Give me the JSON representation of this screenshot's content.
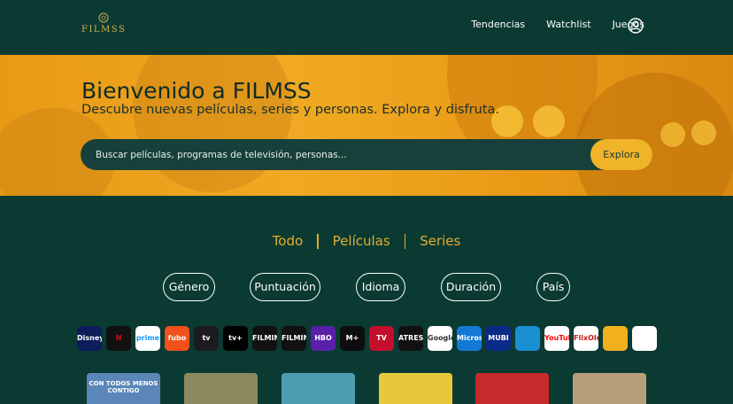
{
  "header": {
    "logo_text": "FILMSS",
    "nav": [
      "Tendencias",
      "Watchlist",
      "Juegos"
    ],
    "user_icon": "user-circle-icon"
  },
  "hero": {
    "title": "Bienvenido a FILMSS",
    "subtitle": "Descubre nuevas películas, series y personas. Explora y disfruta.",
    "search_placeholder": "Buscar películas, programas de televisión, personas...",
    "search_button": "Explora"
  },
  "tabs": [
    "Todo",
    "Películas",
    "Series"
  ],
  "filters": [
    "Género",
    "Puntuación",
    "Idioma",
    "Duración",
    "País"
  ],
  "providers": [
    {
      "name": "disney-plus",
      "label": "Disney+",
      "bg": "#0b1d5a",
      "fg": "#ffffff"
    },
    {
      "name": "netflix",
      "label": "N",
      "bg": "#111111",
      "fg": "#e50914"
    },
    {
      "name": "prime-video",
      "label": "prime video",
      "bg": "#ffffff",
      "fg": "#1a98ff"
    },
    {
      "name": "fubo",
      "label": "fubo",
      "bg": "#f2511b",
      "fg": "#ffffff"
    },
    {
      "name": "apple-tv",
      "label": "tv",
      "bg": "#1c1c1e",
      "fg": "#ffffff"
    },
    {
      "name": "apple-tv-plus",
      "label": "tv+",
      "bg": "#000000",
      "fg": "#ffffff"
    },
    {
      "name": "filmin",
      "label": "FILMIN",
      "bg": "#111111",
      "fg": "#ffffff"
    },
    {
      "name": "filmin-premier",
      "label": "FILMIN",
      "bg": "#111111",
      "fg": "#ffffff"
    },
    {
      "name": "hbo-max",
      "label": "HBO max",
      "bg": "#5a1fa8",
      "fg": "#ffffff"
    },
    {
      "name": "movistar-plus",
      "label": "M+",
      "bg": "#0d0d0d",
      "fg": "#ffffff"
    },
    {
      "name": "rakuten-tv",
      "label": "TV",
      "bg": "#c40f2c",
      "fg": "#ffffff"
    },
    {
      "name": "atres-player",
      "label": "ATRES player",
      "bg": "#111111",
      "fg": "#ffffff"
    },
    {
      "name": "google-play",
      "label": "Google Play",
      "bg": "#ffffff",
      "fg": "#333333"
    },
    {
      "name": "microsoft",
      "label": "Microsoft",
      "bg": "#1479d6",
      "fg": "#ffffff"
    },
    {
      "name": "mubi",
      "label": "MUBI",
      "bg": "#0a2a8a",
      "fg": "#ffffff"
    },
    {
      "name": "filmin-kids",
      "label": "",
      "bg": "#1a8fd1",
      "fg": "#ffffff"
    },
    {
      "name": "youtube-premium",
      "label": "YouTube Premium",
      "bg": "#ffffff",
      "fg": "#ff0000"
    },
    {
      "name": "flixole",
      "label": "FlixOlé",
      "bg": "#ffffff",
      "fg": "#c01a1a"
    },
    {
      "name": "yelo",
      "label": "",
      "bg": "#f2b01e",
      "fg": "#ffffff"
    },
    {
      "name": "filmbox",
      "label": "",
      "bg": "#ffffff",
      "fg": "#7a3bd1"
    }
  ],
  "posters": [
    {
      "name": "poster-1",
      "label": "CON TODOS MENOS CONTIGO",
      "bg": "#5a86b8"
    },
    {
      "name": "poster-2",
      "label": "",
      "bg": "#8a8a5e"
    },
    {
      "name": "poster-3",
      "label": "",
      "bg": "#4a9eb0"
    },
    {
      "name": "poster-4",
      "label": "",
      "bg": "#e8c83a"
    },
    {
      "name": "poster-5",
      "label": "",
      "bg": "#c72a2a"
    },
    {
      "name": "poster-6",
      "label": "",
      "bg": "#b89f7a"
    }
  ],
  "colors": {
    "background": "#0b3a33",
    "accent": "#e3ad2e",
    "hero": "#f0a922"
  }
}
